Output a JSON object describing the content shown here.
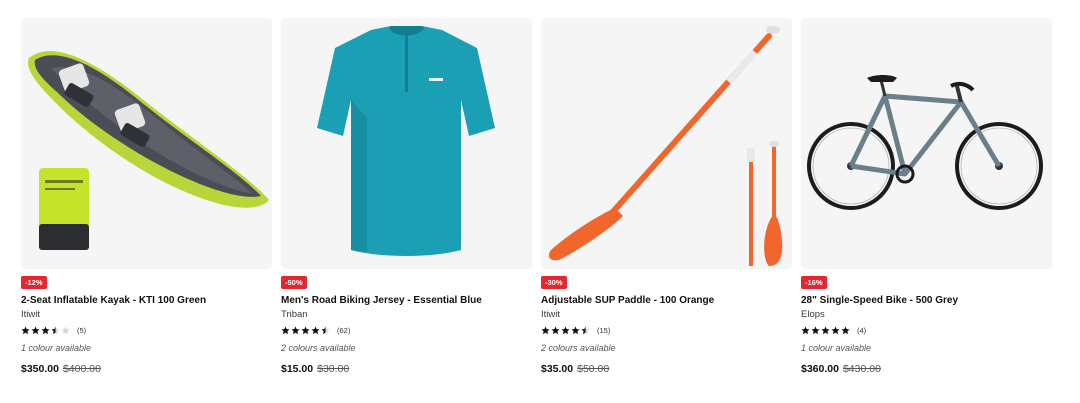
{
  "products": [
    {
      "badge": "-12%",
      "title": "2-Seat Inflatable Kayak - KTI 100 Green",
      "brand": "Itiwit",
      "rating": 3.5,
      "reviews": "(5)",
      "colours": "1 colour available",
      "price": "$350.00",
      "was": "$400.00",
      "image_icon": "kayak-image"
    },
    {
      "badge": "-50%",
      "title": "Men's Road Biking Jersey - Essential Blue",
      "brand": "Triban",
      "rating": 4.5,
      "reviews": "(62)",
      "colours": "2 colours available",
      "price": "$15.00",
      "was": "$30.00",
      "image_icon": "jersey-image"
    },
    {
      "badge": "-30%",
      "title": "Adjustable SUP Paddle - 100 Orange",
      "brand": "Itiwit",
      "rating": 4.5,
      "reviews": "(15)",
      "colours": "2 colours available",
      "price": "$35.00",
      "was": "$50.00",
      "image_icon": "paddle-image"
    },
    {
      "badge": "-16%",
      "title": "28\" Single-Speed Bike - 500 Grey",
      "brand": "Elops",
      "rating": 5,
      "reviews": "(4)",
      "colours": "1 colour available",
      "price": "$360.00",
      "was": "$430.00",
      "image_icon": "bike-image"
    }
  ],
  "colors": {
    "badge": "#e3262f",
    "star": "#101010",
    "star_empty": "#d6d6d6",
    "image_bg": "#f5f5f5"
  }
}
